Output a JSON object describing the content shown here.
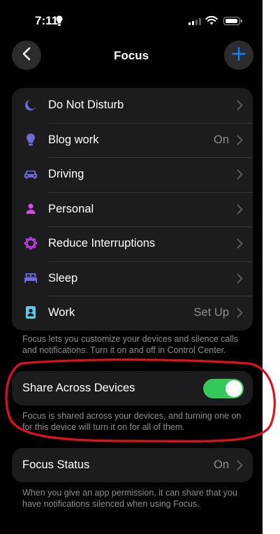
{
  "status_bar": {
    "time": "7:11"
  },
  "nav": {
    "title": "Focus"
  },
  "focus_modes": [
    {
      "label": "Do Not Disturb",
      "value": "",
      "icon": "moon-icon",
      "color": "#6d6bd9"
    },
    {
      "label": "Blog work",
      "value": "On",
      "icon": "lightbulb-icon",
      "color": "#6d6bd9"
    },
    {
      "label": "Driving",
      "value": "",
      "icon": "car-icon",
      "color": "#6d6bd9"
    },
    {
      "label": "Personal",
      "value": "",
      "icon": "person-icon",
      "color": "#d24ee0"
    },
    {
      "label": "Reduce Interruptions",
      "value": "",
      "icon": "interruptions-icon",
      "color": "#c23ee8"
    },
    {
      "label": "Sleep",
      "value": "",
      "icon": "bed-icon",
      "color": "#6d6bd9"
    },
    {
      "label": "Work",
      "value": "Set Up",
      "icon": "work-badge-icon",
      "color": "#5ec9e6"
    }
  ],
  "focus_footnote": "Focus lets you customize your devices and silence calls and notifications. Turn it on and off in Control Center.",
  "share": {
    "label": "Share Across Devices",
    "enabled": true,
    "footnote": "Focus is shared across your devices, and turning one on for this device will turn it on for all of them."
  },
  "focus_status": {
    "label": "Focus Status",
    "value": "On",
    "footnote": "When you give an app permission, it can share that you have notifications silenced when using Focus."
  },
  "colors": {
    "accent": "#0a84ff",
    "toggle_on": "#34c759",
    "annotation": "#e0101c"
  }
}
